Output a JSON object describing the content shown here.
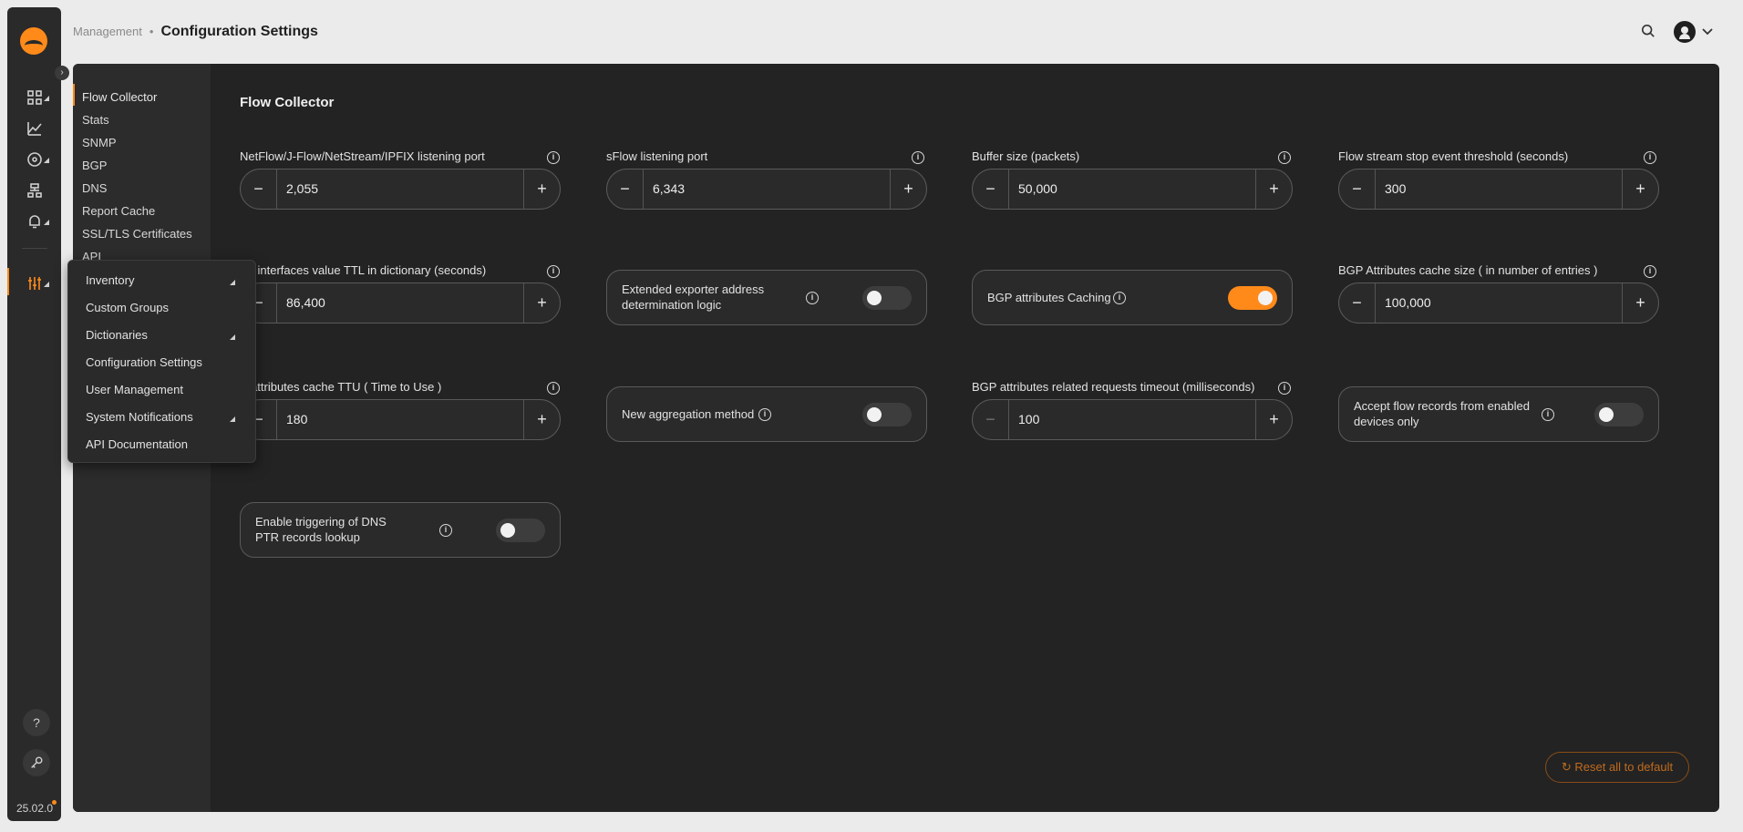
{
  "breadcrumb": {
    "parent": "Management",
    "separator": "•",
    "current": "Configuration Settings"
  },
  "rail": {
    "version": "25.02.0"
  },
  "subnav": {
    "items": [
      "Flow Collector",
      "Stats",
      "SNMP",
      "BGP",
      "DNS",
      "Report Cache",
      "SSL/TLS Certificates",
      "API"
    ]
  },
  "menu": {
    "items": [
      "Inventory",
      "Custom Groups",
      "Dictionaries",
      "Configuration Settings",
      "User Management",
      "System Notifications",
      "API Documentation"
    ]
  },
  "content": {
    "title": "Flow Collector",
    "fields": {
      "netflow_port": {
        "label": "NetFlow/J-Flow/NetStream/IPFIX listening port",
        "value": "2,055"
      },
      "sflow_port": {
        "label": "sFlow listening port",
        "value": "6,343"
      },
      "buffer_size": {
        "label": "Buffer size (packets)",
        "value": "50,000"
      },
      "stop_threshold": {
        "label": "Flow stream stop event threshold (seconds)",
        "value": "300"
      },
      "flows_ttl": {
        "label": "ws interfaces value TTL in dictionary (seconds)",
        "value": "86,400"
      },
      "extended_exporter": {
        "label": "Extended exporter address determination logic",
        "on": false
      },
      "bgp_caching": {
        "label": "BGP attributes Caching",
        "on": true
      },
      "bgp_cache_size": {
        "label": "BGP Attributes cache size ( in number of entries )",
        "value": "100,000"
      },
      "bgp_ttu": {
        "label": "P attributes cache TTU ( Time to Use )",
        "value": "180"
      },
      "new_aggregation": {
        "label": "New aggregation method",
        "on": false
      },
      "bgp_timeout": {
        "label": "BGP attributes related requests timeout (milliseconds)",
        "value": "100"
      },
      "accept_enabled": {
        "label": "Accept flow records from enabled devices only",
        "on": false
      },
      "dns_ptr": {
        "label": "Enable triggering of DNS PTR records lookup",
        "on": false
      }
    },
    "reset_label": "Reset all to default"
  },
  "colors": {
    "accent": "#ff8a1a",
    "panel": "#232323",
    "background": "#ebebeb"
  }
}
